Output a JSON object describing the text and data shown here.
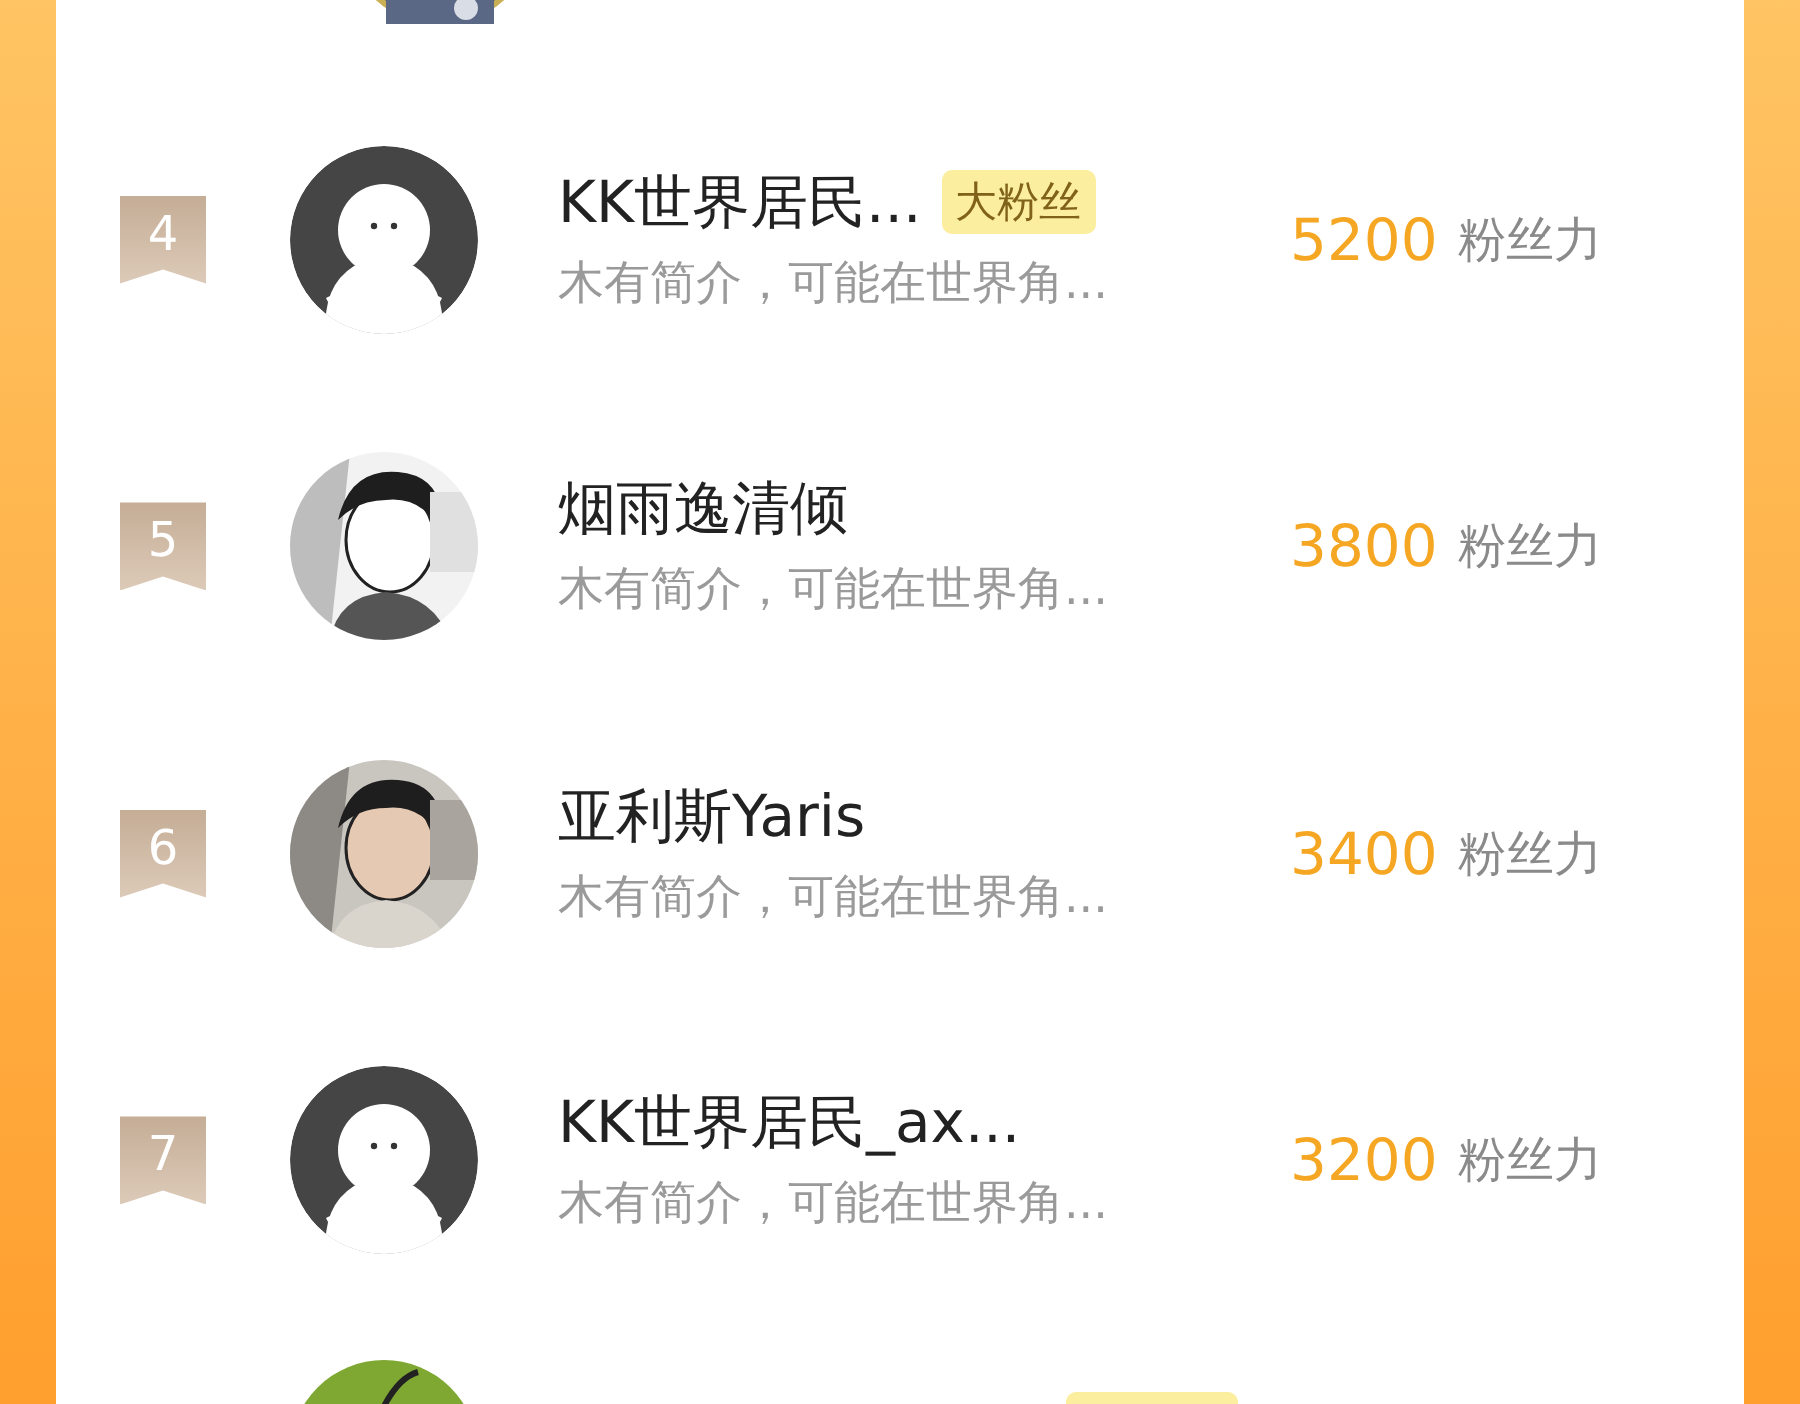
{
  "rows": [
    {
      "rank": "4",
      "avatar": {
        "kind": "default"
      },
      "name": "KK世界居民...",
      "badge": "大粉丝",
      "bio": "木有简介，可能在世界角...",
      "score": "5200",
      "unit": "粉丝力"
    },
    {
      "rank": "5",
      "name": "烟雨逸清倾",
      "bio": "木有简介，可能在世界角...",
      "score": "3800",
      "unit": "粉丝力"
    },
    {
      "rank": "6",
      "name": "亚利斯Yaris",
      "bio": "木有简介，可能在世界角...",
      "score": "3400",
      "unit": "粉丝力"
    },
    {
      "rank": "7",
      "avatar": {
        "kind": "default"
      },
      "name": "KK世界居民_ax...",
      "bio": "木有简介，可能在世界角...",
      "score": "3200",
      "unit": "粉丝力"
    }
  ]
}
